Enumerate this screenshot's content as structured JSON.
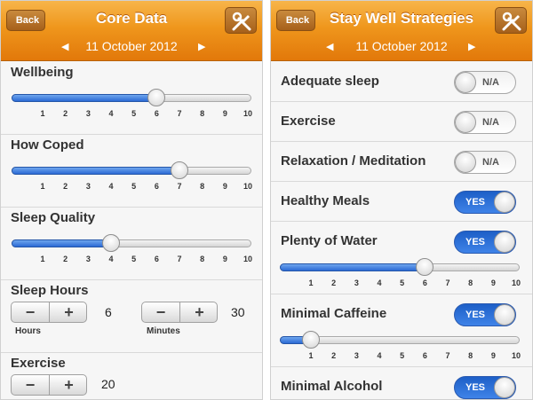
{
  "left": {
    "back_label": "Back",
    "title": "Core Data",
    "date": "11 October 2012",
    "tick_labels": [
      "1",
      "2",
      "3",
      "4",
      "5",
      "6",
      "7",
      "8",
      "9",
      "10"
    ],
    "sliders": [
      {
        "label": "Wellbeing",
        "value": 6
      },
      {
        "label": "How Coped",
        "value": 7
      },
      {
        "label": "Sleep Quality",
        "value": 4
      }
    ],
    "sleep_hours": {
      "label": "Sleep Hours",
      "hours_value": "6",
      "hours_unit": "Hours",
      "minutes_value": "30",
      "minutes_unit": "Minutes"
    },
    "exercise": {
      "label": "Exercise",
      "value": "20"
    },
    "stepper_minus": "−",
    "stepper_plus": "+"
  },
  "right": {
    "back_label": "Back",
    "title": "Stay Well Strategies",
    "date": "11 October 2012",
    "tick_labels": [
      "1",
      "2",
      "3",
      "4",
      "5",
      "6",
      "7",
      "8",
      "9",
      "10"
    ],
    "strategies": [
      {
        "label": "Adequate sleep",
        "state": "N/A",
        "on": false
      },
      {
        "label": "Exercise",
        "state": "N/A",
        "on": false
      },
      {
        "label": "Relaxation / Meditation",
        "state": "N/A",
        "on": false
      },
      {
        "label": "Healthy Meals",
        "state": "YES",
        "on": true
      },
      {
        "label": "Plenty of Water",
        "state": "YES",
        "on": true,
        "slider_value": 6
      },
      {
        "label": "Minimal Caffeine",
        "state": "YES",
        "on": true,
        "slider_value": 1
      },
      {
        "label": "Minimal Alcohol",
        "state": "YES",
        "on": true
      }
    ]
  },
  "icons": {
    "prev": "triangle-left-icon",
    "next": "triangle-right-icon",
    "tools": "tools-wrench-screwdriver-icon"
  },
  "colors": {
    "header_orange": "#ef961c",
    "slider_blue": "#2b6ad4",
    "toggle_on_blue": "#2f72dc"
  }
}
